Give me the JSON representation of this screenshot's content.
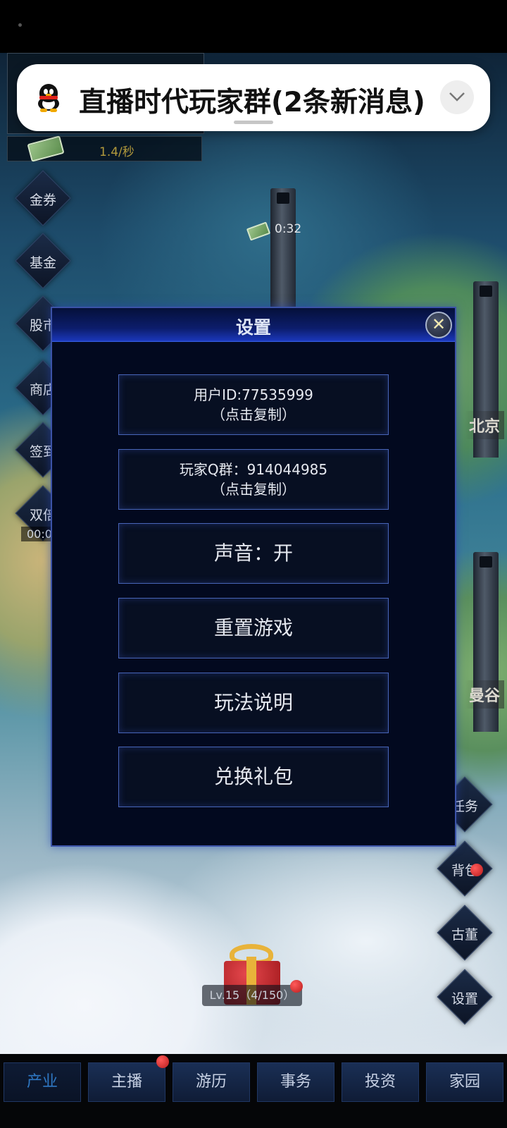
{
  "notification": {
    "app_icon": "qq-penguin-icon",
    "title": "直播时代玩家群(2条新消息)",
    "expand_icon": "chevron-down-icon"
  },
  "hud": {
    "money_rate": "1.4/秒",
    "timer": "0:32"
  },
  "side_left": [
    "金券",
    "基金",
    "股市",
    "商店",
    "签到",
    "双倍"
  ],
  "double_timer": "00:0",
  "side_right": [
    "任务",
    "背包",
    "古董",
    "设置"
  ],
  "cities": [
    "北京",
    "曼谷"
  ],
  "level": "Lv.15（4/150）",
  "settings_modal": {
    "title": "设置",
    "user_id": {
      "line1": "用户ID:77535999",
      "line2": "（点击复制）"
    },
    "qq_group": {
      "line1": "玩家Q群：914044985",
      "line2": "（点击复制）"
    },
    "sound": "声音：开",
    "reset": "重置游戏",
    "guide": "玩法说明",
    "redeem": "兑换礼包"
  },
  "bottom_nav": {
    "tabs": [
      "产业",
      "主播",
      "游历",
      "事务",
      "投资",
      "家园"
    ],
    "active": "产业"
  }
}
